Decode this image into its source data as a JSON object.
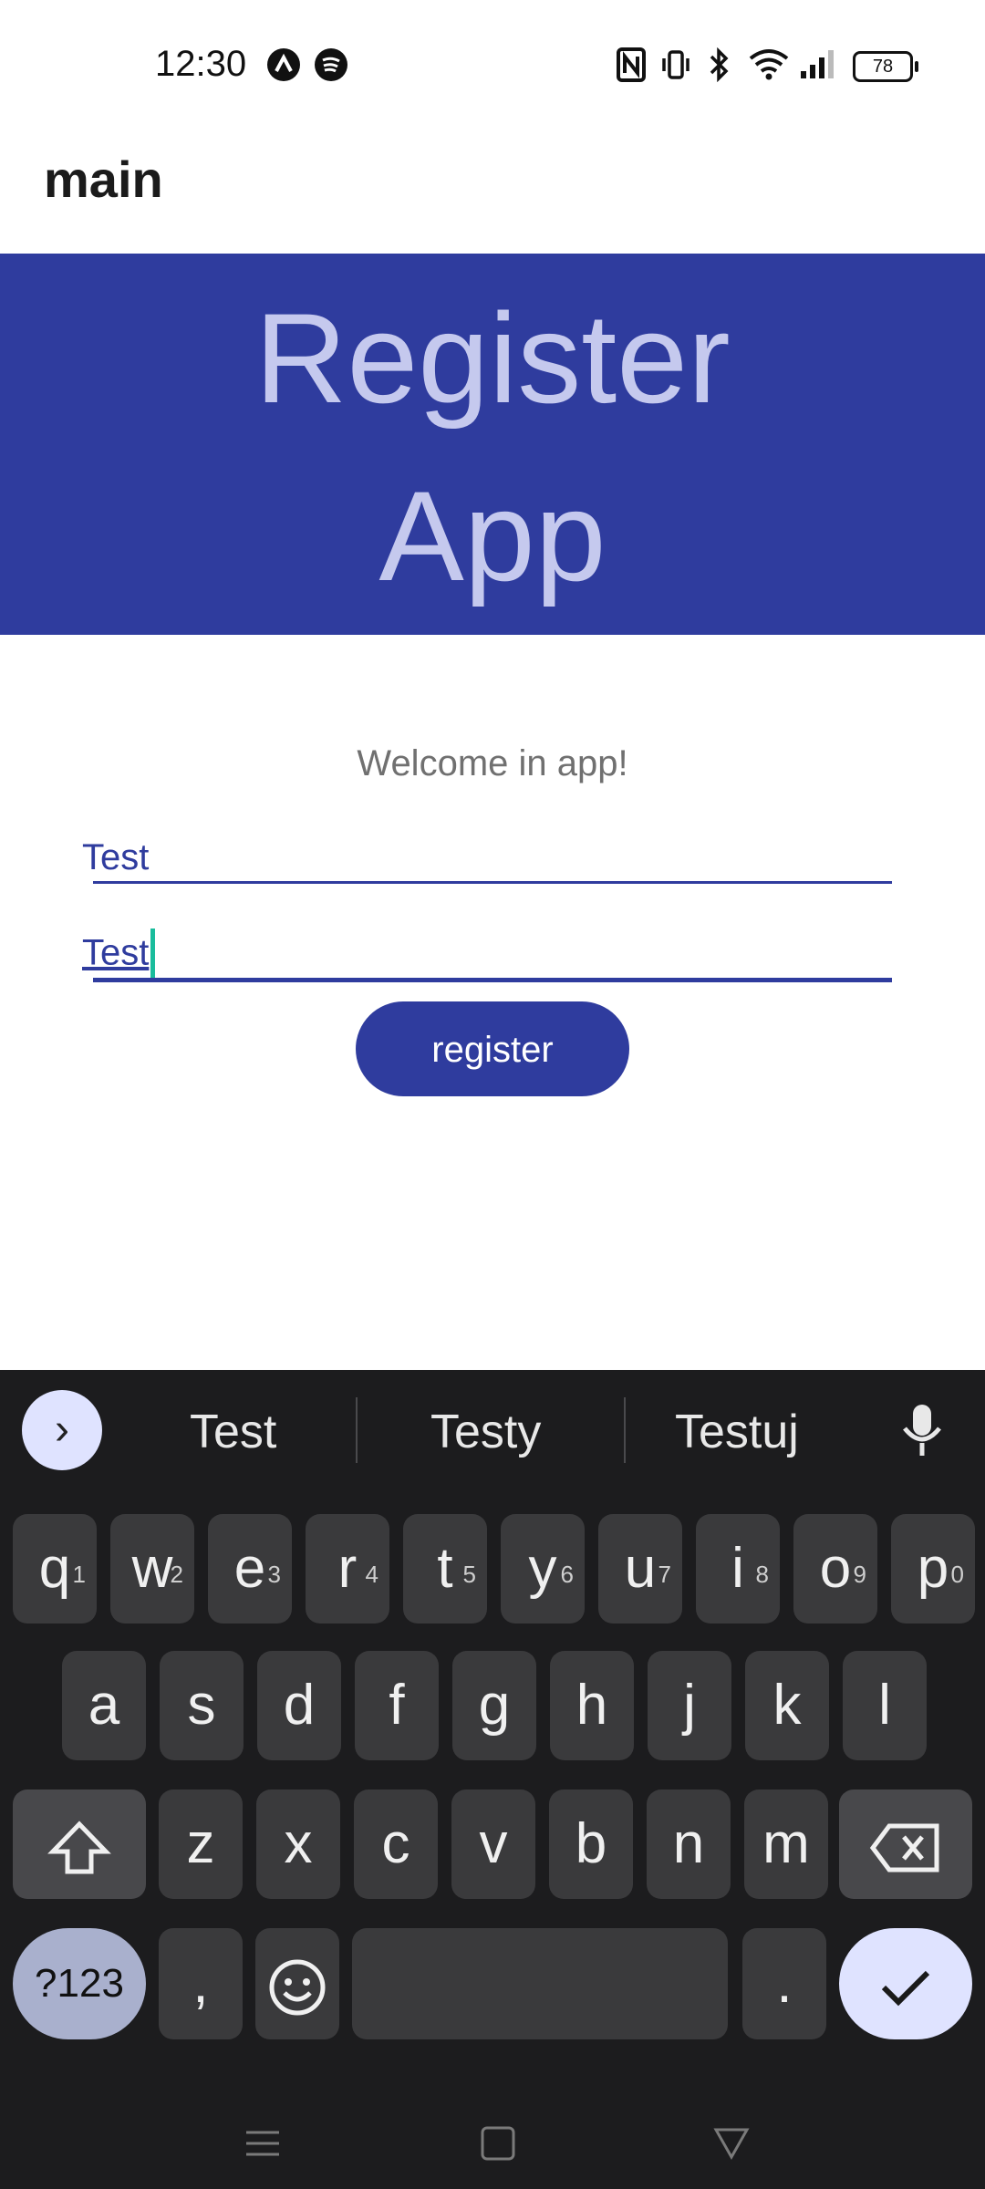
{
  "status": {
    "time": "12:30",
    "battery": "78",
    "icons": [
      "app-icon",
      "spotify-icon",
      "nfc-icon",
      "vibrate-icon",
      "bluetooth-icon",
      "wifi-icon",
      "signal-icon"
    ]
  },
  "app_bar": {
    "title": "main"
  },
  "header": {
    "line1": "Register",
    "line2": "App"
  },
  "form": {
    "welcome": "Welcome in app!",
    "field1_value": "Test",
    "field2_value": "Test",
    "register_label": "register"
  },
  "keyboard": {
    "suggestions": [
      "Test",
      "Testy",
      "Testuj"
    ],
    "row1": [
      [
        "q",
        "1"
      ],
      [
        "w",
        "2"
      ],
      [
        "e",
        "3"
      ],
      [
        "r",
        "4"
      ],
      [
        "t",
        "5"
      ],
      [
        "y",
        "6"
      ],
      [
        "u",
        "7"
      ],
      [
        "i",
        "8"
      ],
      [
        "o",
        "9"
      ],
      [
        "p",
        "0"
      ]
    ],
    "row2": [
      "a",
      "s",
      "d",
      "f",
      "g",
      "h",
      "j",
      "k",
      "l"
    ],
    "row3": [
      "z",
      "x",
      "c",
      "v",
      "b",
      "n",
      "m"
    ],
    "sym_label": "?123",
    "comma": ",",
    "period": "."
  },
  "colors": {
    "primary": "#2f3c9e",
    "header_text": "#c5c9ee",
    "keyboard_bg": "#1c1c1e",
    "key_bg": "#3a3a3c",
    "cursor": "#1abc9c"
  }
}
